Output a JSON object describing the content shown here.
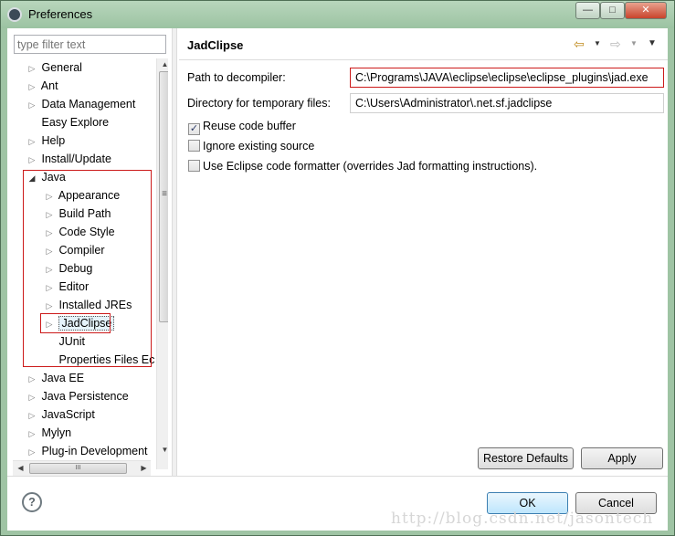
{
  "window": {
    "title": "Preferences",
    "controls": {
      "minimize": "—",
      "maximize": "□",
      "close": "✕"
    }
  },
  "filter": {
    "placeholder": "type filter text"
  },
  "tree": {
    "top": [
      {
        "label": "General",
        "twisty": "closed"
      },
      {
        "label": "Ant",
        "twisty": "closed"
      },
      {
        "label": "Data Management",
        "twisty": "closed"
      },
      {
        "label": "Easy Explore",
        "twisty": "none"
      },
      {
        "label": "Help",
        "twisty": "closed"
      },
      {
        "label": "Install/Update",
        "twisty": "closed"
      },
      {
        "label": "Java",
        "twisty": "open"
      }
    ],
    "java_children": [
      {
        "label": "Appearance",
        "twisty": "closed"
      },
      {
        "label": "Build Path",
        "twisty": "closed"
      },
      {
        "label": "Code Style",
        "twisty": "closed"
      },
      {
        "label": "Compiler",
        "twisty": "closed"
      },
      {
        "label": "Debug",
        "twisty": "closed"
      },
      {
        "label": "Editor",
        "twisty": "closed"
      },
      {
        "label": "Installed JREs",
        "twisty": "closed"
      },
      {
        "label": "JadClipse",
        "twisty": "closed",
        "selected": true
      },
      {
        "label": "JUnit",
        "twisty": "none"
      },
      {
        "label": "Properties Files Ec",
        "twisty": "none"
      }
    ],
    "bottom": [
      {
        "label": "Java EE",
        "twisty": "closed"
      },
      {
        "label": "Java Persistence",
        "twisty": "closed"
      },
      {
        "label": "JavaScript",
        "twisty": "closed"
      },
      {
        "label": "Mylyn",
        "twisty": "closed"
      },
      {
        "label": "Plug-in Development",
        "twisty": "closed"
      }
    ]
  },
  "page": {
    "title": "JadClipse",
    "path_label": "Path to decompiler:",
    "path_value": "C:\\Programs\\JAVA\\eclipse\\eclipse\\eclipse_plugins\\jad.exe",
    "tempdir_label": "Directory for temporary files:",
    "tempdir_value": "C:\\Users\\Administrator\\.net.sf.jadclipse",
    "checkboxes": [
      {
        "label": "Reuse code buffer",
        "checked": true
      },
      {
        "label": "Ignore existing source",
        "checked": false
      },
      {
        "label": "Use Eclipse code formatter (overrides Jad formatting instructions).",
        "checked": false
      }
    ],
    "restore_defaults": "Restore Defaults",
    "apply": "Apply"
  },
  "buttons": {
    "ok": "OK",
    "cancel": "Cancel",
    "help": "?"
  },
  "icons": {
    "back": "⇦",
    "forward": "⇨",
    "dropdown": "▼",
    "menu": "▼",
    "twisty_closed": "▷",
    "twisty_open": "◢",
    "grip": "≡",
    "scroll_up": "▲",
    "scroll_down": "▼",
    "scroll_left": "◀",
    "scroll_right": "▶",
    "hgrip": "III"
  },
  "colors": {
    "highlight": "#cc1a1a",
    "selection": "#e5f3fb",
    "frame": "#9fc4a4"
  },
  "watermark": "http://blog.csdn.net/jasontech"
}
